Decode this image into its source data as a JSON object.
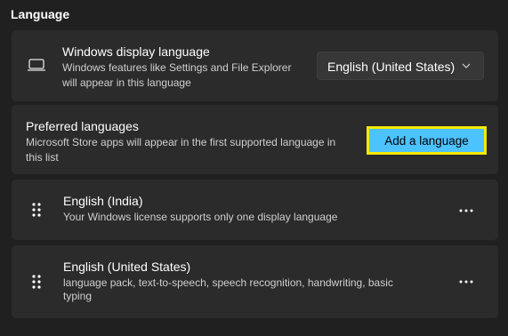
{
  "section": {
    "title": "Language"
  },
  "display_language": {
    "icon": "monitor-icon",
    "title": "Windows display language",
    "description_line1": "Windows features like Settings and File Explorer",
    "description_line2": "will appear in this language",
    "selected_value": "English (United States)"
  },
  "preferred": {
    "title": "Preferred languages",
    "description_line1": "Microsoft Store apps will appear in the first supported language in",
    "description_line2": "this list",
    "add_button_label": "Add a language"
  },
  "languages": [
    {
      "name": "English (India)",
      "description_line1": "Your Windows license supports only one display language"
    },
    {
      "name": "English (United States)",
      "description_line1": "language pack, text-to-speech, speech recognition, handwriting, basic",
      "description_line2": "typing"
    }
  ],
  "colors": {
    "background": "#202020",
    "card": "#2b2b2b",
    "accent_button": "#4cc2ff",
    "highlight_border": "#f5ea00"
  }
}
